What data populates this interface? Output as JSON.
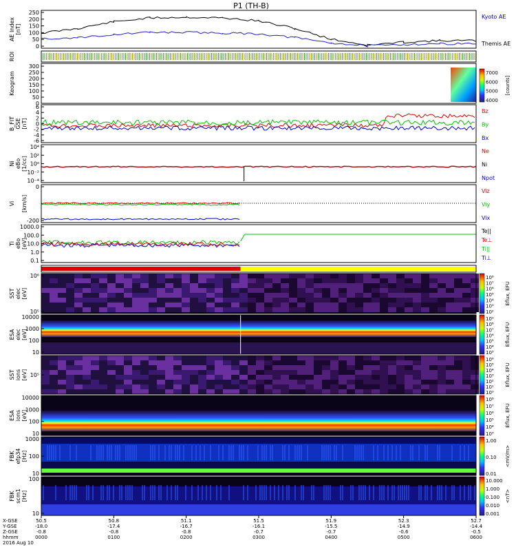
{
  "title": "P1 (TH-B)",
  "colors": {
    "frame": "#000000",
    "kyoto": "#000000",
    "themis": "#2020c0",
    "bz": "#e00000",
    "by": "#00c000",
    "bx": "#0000d0",
    "mode_slow": "#e00000",
    "mode_fast": "#ffff00"
  },
  "panels": [
    {
      "key": "ae",
      "ylabel": [
        "AE Index",
        "[nT]"
      ],
      "ticks": [
        "250",
        "200",
        "150",
        "100",
        "50",
        "0"
      ],
      "legend": [
        {
          "text": "Kyoto AE",
          "color": "#0000c0"
        },
        {
          "text": "Themis AE",
          "color": "#000000"
        }
      ]
    },
    {
      "key": "roi",
      "ylabel": [
        "ROI"
      ],
      "ticks": [],
      "legend": []
    },
    {
      "key": "keogram",
      "ylabel": [
        "Keogram"
      ],
      "ticks": [
        "300",
        "250",
        "200",
        "150",
        "100",
        "50",
        "0"
      ],
      "legend": []
    },
    {
      "key": "bfield",
      "ylabel": [
        "B_FIT",
        "GSE",
        "[nT]"
      ],
      "ticks": [
        "6",
        "4",
        "2",
        "0",
        "-2",
        "-4",
        "-6"
      ],
      "legend": [
        {
          "text": "Bz",
          "color": "#e00000"
        },
        {
          "text": "By",
          "color": "#00c000"
        },
        {
          "text": "Bx",
          "color": "#0000d0"
        }
      ]
    },
    {
      "key": "density",
      "ylabel": [
        "Ni",
        "eBo",
        "[1/cc]"
      ],
      "ticks": [
        "10⁴",
        "10²",
        "10⁰",
        "10⁻²",
        "10⁻⁴"
      ],
      "legend": [
        {
          "text": "Ne",
          "color": "#e00000"
        },
        {
          "text": "Ni",
          "color": "#000000"
        },
        {
          "text": "Npot",
          "color": "#0000d0"
        }
      ]
    },
    {
      "key": "velocity",
      "ylabel": [
        "Vi",
        "",
        "[km/s]"
      ],
      "ticks": [
        "0",
        "-200"
      ],
      "legend": [
        {
          "text": "Viz",
          "color": "#e00000"
        },
        {
          "text": "Viy",
          "color": "#00c000"
        },
        {
          "text": "Vix",
          "color": "#0000d0"
        }
      ]
    },
    {
      "key": "temperature",
      "ylabel": [
        "Ti",
        "eBo",
        "[eV]"
      ],
      "ticks": [
        "1000.0",
        "100.0",
        "10.0",
        "1.0",
        "0.1"
      ],
      "legend": [
        {
          "text": "Te||",
          "color": "#000000"
        },
        {
          "text": "Te⊥",
          "color": "#e00000"
        },
        {
          "text": "Ti||",
          "color": "#00c000"
        },
        {
          "text": "Ti⊥",
          "color": "#0000d0"
        }
      ]
    },
    {
      "key": "mode",
      "ylabel": [],
      "ticks": [],
      "legend": []
    },
    {
      "key": "sst_e",
      "ylabel": [
        "SST",
        "elec",
        "[eV]"
      ],
      "ticks": [
        "10⁶",
        "10⁵"
      ],
      "legend": []
    },
    {
      "key": "esa_e",
      "ylabel": [
        "ESA",
        "elec",
        "[eV]"
      ],
      "ticks": [
        "10000",
        "1000",
        "100",
        "10"
      ],
      "legend": []
    },
    {
      "key": "sst_i",
      "ylabel": [
        "SST",
        "ions",
        "[eV]"
      ],
      "ticks": [
        "10⁵"
      ],
      "legend": []
    },
    {
      "key": "esa_i",
      "ylabel": [
        "ESA",
        "ions",
        "[eV]"
      ],
      "ticks": [
        "10000",
        "1000",
        "100",
        "10"
      ],
      "legend": []
    },
    {
      "key": "fbk1",
      "ylabel": [
        "FBK",
        "efp34",
        "[Hz]"
      ],
      "ticks": [
        "1000",
        "100",
        "10"
      ],
      "legend": []
    },
    {
      "key": "fbk2",
      "ylabel": [
        "FBK",
        "scm1",
        "[Hz]"
      ],
      "ticks": [
        "100",
        "10"
      ],
      "legend": []
    }
  ],
  "colorbars": [
    {
      "key": "keogram",
      "ticks": [
        "7000",
        "6000",
        "5000",
        "4000"
      ],
      "unit": "[counts]"
    },
    {
      "key": "sst_e",
      "ticks": [
        "10⁸",
        "10⁷",
        "10⁶",
        "10⁵",
        "10⁴",
        "10³",
        "10²"
      ],
      "unit": "Eflux, EFU"
    },
    {
      "key": "esa_e",
      "ticks": [
        "10⁹",
        "10⁸",
        "10⁷",
        "10⁶",
        "10⁵",
        "10⁴",
        "10³"
      ],
      "unit": "Eflux, EFU"
    },
    {
      "key": "sst_i",
      "ticks": [
        "10⁶",
        "10⁵",
        "10⁴",
        "10³",
        "10²",
        "10¹",
        "10⁰"
      ],
      "unit": "Eflux, EFU"
    },
    {
      "key": "esa_i",
      "ticks": [
        "10⁸",
        "10⁷",
        "10⁶",
        "10⁵",
        "10⁴",
        "10³"
      ],
      "unit": "Eflux, EFU"
    },
    {
      "key": "fbk1",
      "ticks": [
        "1.00",
        "0.10",
        "0.01"
      ],
      "unit": "<mV/m>"
    },
    {
      "key": "fbk2",
      "ticks": [
        "10.000",
        "1.000",
        "0.100",
        "0.010",
        "0.001"
      ],
      "unit": "<nT>"
    }
  ],
  "xaxis": {
    "row_labels": [
      "X-GSE",
      "Y-GSE",
      "Z-GSE",
      "hhmm",
      "2016 Aug 10"
    ],
    "columns": [
      [
        "50.5",
        "-18.0",
        "-0.8",
        "0000"
      ],
      [
        "50.8",
        "-17.4",
        "-0.8",
        "0100"
      ],
      [
        "51.1",
        "-16.7",
        "-0.8",
        "0200"
      ],
      [
        "51.5",
        "-16.1",
        "-0.7",
        "0300"
      ],
      [
        "51.9",
        "-15.5",
        "-0.7",
        "0400"
      ],
      [
        "52.3",
        "-14.9",
        "-0.6",
        "0500"
      ],
      [
        "52.7",
        "-14.4",
        "-0.5",
        "0600"
      ]
    ]
  },
  "chart_data": {
    "type": "line",
    "x_hours": [
      0,
      0.5,
      1,
      1.5,
      2,
      2.5,
      3,
      3.5,
      4,
      4.5,
      5,
      5.5,
      6
    ],
    "series": [
      {
        "name": "Kyoto AE",
        "values": [
          100,
          130,
          175,
          200,
          205,
          200,
          180,
          130,
          60,
          20,
          40,
          50,
          50
        ]
      },
      {
        "name": "Themis AE",
        "values": [
          60,
          70,
          90,
          105,
          105,
          100,
          95,
          70,
          35,
          15,
          25,
          30,
          30
        ]
      }
    ],
    "mode_switch_hour": 2.75,
    "ylim": [
      0,
      250
    ]
  }
}
